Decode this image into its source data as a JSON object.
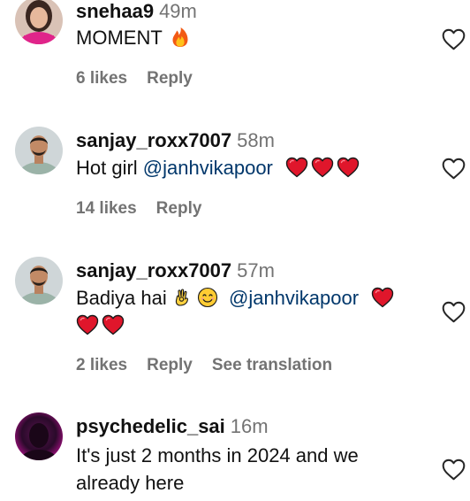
{
  "comments": [
    {
      "username": "snehaa9",
      "time": "49m",
      "text": "MOMENT",
      "likes": "6 likes",
      "reply": "Reply"
    },
    {
      "username": "sanjay_roxx7007",
      "time": "58m",
      "text": "Hot girl ",
      "mention": "@janhvikapoor",
      "likes": "14 likes",
      "reply": "Reply"
    },
    {
      "username": "sanjay_roxx7007",
      "time": "57m",
      "text": "Badiya hai ",
      "mention": "@janhvikapoor",
      "likes": "2 likes",
      "reply": "Reply",
      "translation": "See translation"
    },
    {
      "username": "psychedelic_sai",
      "time": "16m",
      "text": "It's just 2 months in 2024 and we already here"
    }
  ],
  "icons": {
    "like": "heart-outline-icon",
    "fire": "fire-emoji",
    "red_heart": "red-heart-emoji",
    "ok_hand": "ok-hand-emoji",
    "smile": "smiling-face-emoji"
  },
  "colors": {
    "text": "#111111",
    "muted": "#737373",
    "mention": "#00376b",
    "heart_red": "#e0162b"
  }
}
